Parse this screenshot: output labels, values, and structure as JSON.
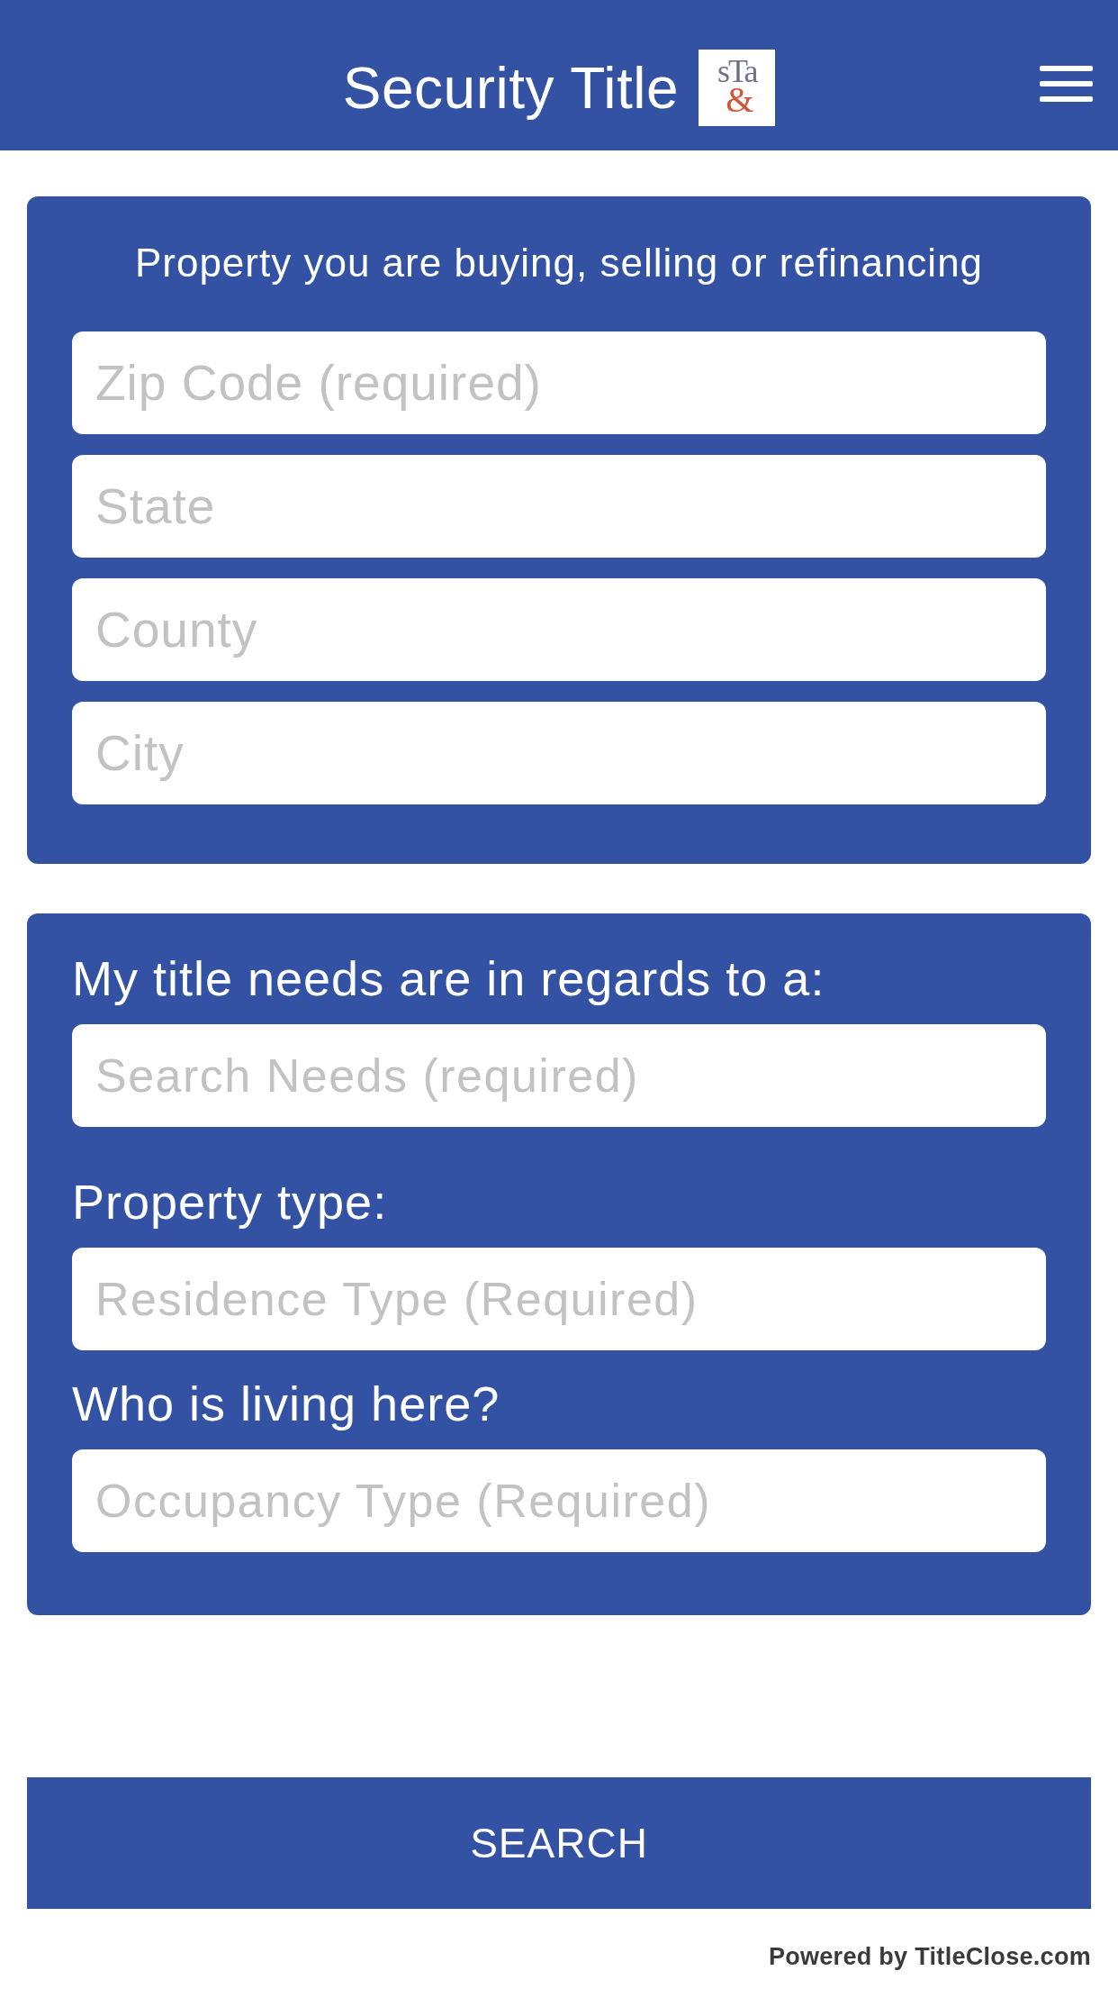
{
  "header": {
    "title": "Security Title",
    "logo": {
      "letters": "sTa",
      "mark": "&"
    }
  },
  "property_card": {
    "heading": "Property you are buying, selling or refinancing",
    "fields": [
      {
        "placeholder": "Zip Code (required)"
      },
      {
        "placeholder": "State"
      },
      {
        "placeholder": "County"
      },
      {
        "placeholder": "City"
      }
    ]
  },
  "needs_card": {
    "groups": [
      {
        "label": "My title needs are in regards to a:",
        "placeholder": "Search Needs (required)"
      },
      {
        "label": "Property type:",
        "placeholder": "Residence Type (Required)"
      },
      {
        "label": "Who is living here?",
        "placeholder": "Occupancy Type (Required)"
      }
    ]
  },
  "search_button": {
    "label": "SEARCH"
  },
  "footer": {
    "text": "Powered by TitleClose.com"
  }
}
